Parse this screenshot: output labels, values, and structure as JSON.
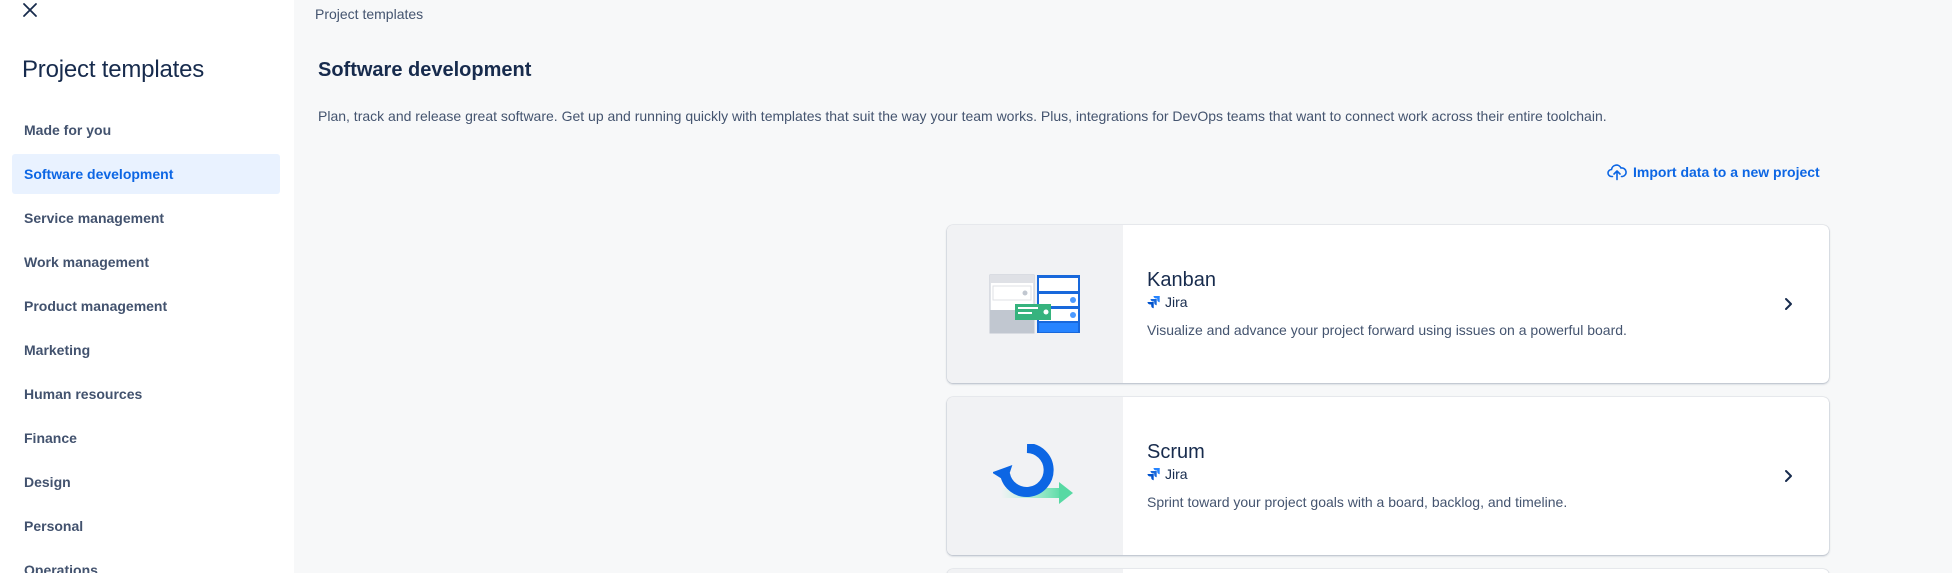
{
  "sidebar": {
    "title": "Project templates",
    "items": [
      {
        "label": "Made for you",
        "active": false
      },
      {
        "label": "Software development",
        "active": true
      },
      {
        "label": "Service management",
        "active": false
      },
      {
        "label": "Work management",
        "active": false
      },
      {
        "label": "Product management",
        "active": false
      },
      {
        "label": "Marketing",
        "active": false
      },
      {
        "label": "Human resources",
        "active": false
      },
      {
        "label": "Finance",
        "active": false
      },
      {
        "label": "Design",
        "active": false
      },
      {
        "label": "Personal",
        "active": false
      },
      {
        "label": "Operations",
        "active": false
      }
    ]
  },
  "main": {
    "breadcrumb": "Project templates",
    "section_title": "Software development",
    "section_desc": "Plan, track and release great software. Get up and running quickly with templates that suit the way your team works. Plus, integrations for DevOps teams that want to connect work across their entire toolchain.",
    "import_label": "Import data to a new project",
    "templates": [
      {
        "title": "Kanban",
        "product": "Jira",
        "description": "Visualize and advance your project forward using issues on a powerful board."
      },
      {
        "title": "Scrum",
        "product": "Jira",
        "description": "Sprint toward your project goals with a board, backlog, and timeline."
      }
    ]
  },
  "colors": {
    "accent": "#0c66e4",
    "active_bg": "#e9f2ff",
    "text_primary": "#172b4d",
    "text_secondary": "#44546f"
  },
  "icons": [
    "close-icon",
    "upload-cloud-icon",
    "jira-icon",
    "chevron-right-icon"
  ]
}
